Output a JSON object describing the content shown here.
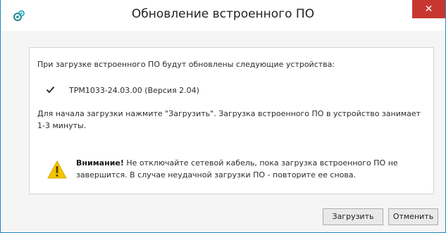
{
  "window": {
    "title": "Обновление встроенного ПО",
    "close_label": "✕"
  },
  "panel": {
    "intro": "При загрузке встроенного ПО будут обновлены следующие устройства:",
    "devices": [
      {
        "label": "ТРМ1033-24.03.00 (Версия 2.04)",
        "checked": true
      }
    ],
    "instruction": "Для начала загрузки нажмите \"Загрузить\". Загрузка встроенного ПО в устройство занимает 1-3 минуты.",
    "warning_title": "Внимание!",
    "warning_text": "Не отключайте сетевой кабель, пока загрузка встроенного ПО не завершится. В случае неудачной загрузки ПО - повторите ее снова."
  },
  "buttons": {
    "load": "Загрузить",
    "cancel": "Отменить"
  },
  "colors": {
    "window_border": "#1e88c9",
    "close_button": "#c7372f",
    "warning_icon": "#f5c400"
  }
}
